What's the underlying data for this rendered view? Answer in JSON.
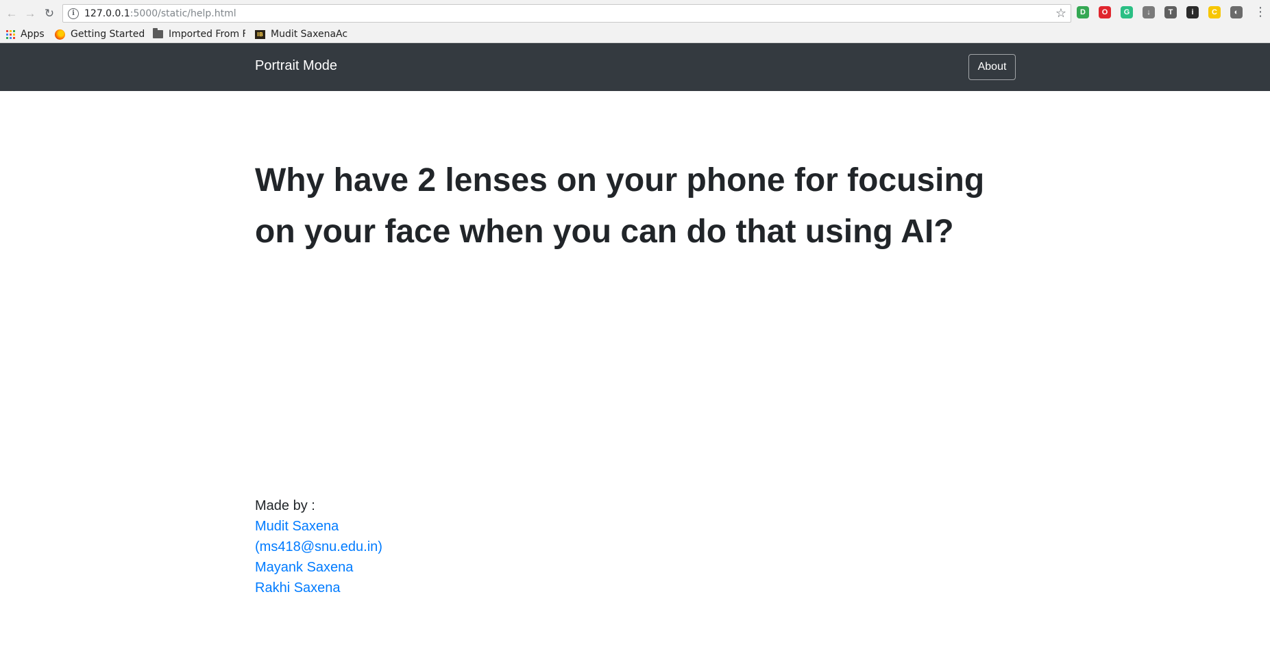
{
  "browser": {
    "url_host": "127.0.0.1",
    "url_rest": ":5000/static/help.html",
    "bookmarks": [
      {
        "label": "Apps",
        "icon": "apps-grid-icon"
      },
      {
        "label": "Getting Started",
        "icon": "firefox-icon"
      },
      {
        "label": "Imported From F",
        "icon": "folder-icon"
      },
      {
        "label": "Mudit SaxenaAc",
        "icon": "imdb-icon"
      }
    ],
    "extensions": [
      {
        "name": "ext-green-icon",
        "color": "#34a853",
        "glyph": "D"
      },
      {
        "name": "ext-opera-icon",
        "color": "#e0262e",
        "glyph": "O"
      },
      {
        "name": "ext-teal-icon",
        "color": "#2bbf84",
        "glyph": "G"
      },
      {
        "name": "ext-download-icon",
        "color": "#7a7a7a",
        "glyph": "↓"
      },
      {
        "name": "ext-t-icon",
        "color": "#5f5f5f",
        "glyph": "T"
      },
      {
        "name": "ext-dark-icon",
        "color": "#2b2b2b",
        "glyph": "i"
      },
      {
        "name": "ext-pacman-icon",
        "color": "#f7c600",
        "glyph": "C"
      },
      {
        "name": "ext-shield-icon",
        "color": "#6b6b6b",
        "glyph": "◐"
      }
    ]
  },
  "navbar": {
    "brand": "Portrait Mode",
    "about_label": "About"
  },
  "headline": "Why have 2 lenses on your phone for focusing on your face when you can do that using AI?",
  "credits": {
    "label": "Made by :",
    "links": [
      "Mudit Saxena",
      "(ms418@snu.edu.in)",
      "Mayank Saxena",
      "Rakhi Saxena"
    ]
  }
}
